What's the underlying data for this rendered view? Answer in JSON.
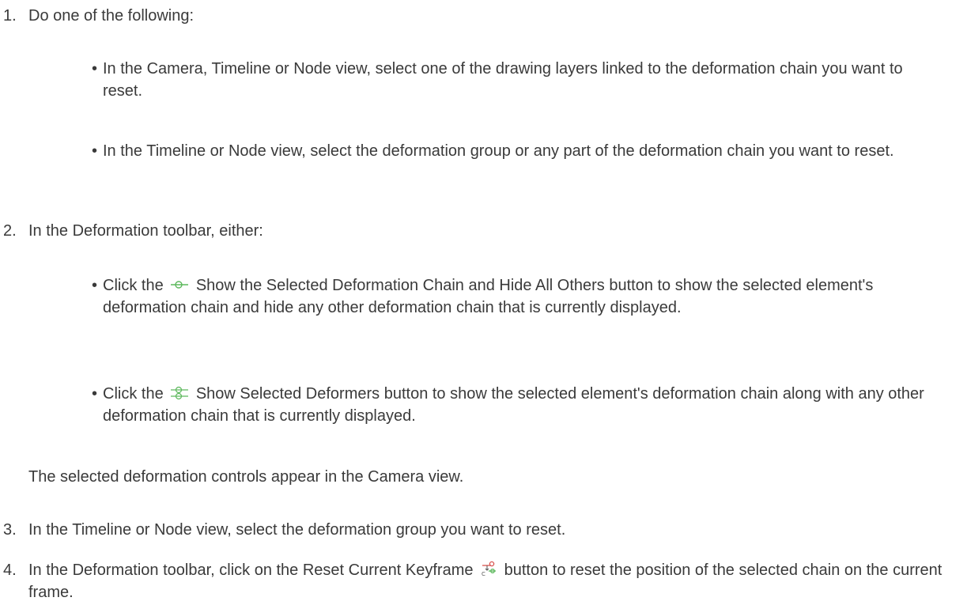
{
  "step1": {
    "num": "1.",
    "text": "Do one of the following:",
    "bullets": [
      "In the Camera, Timeline or Node view, select one of the drawing layers linked to the deformation chain you want to reset.",
      "In the Timeline or Node view, select the deformation group or any part of the deformation chain you want to reset."
    ]
  },
  "step2": {
    "num": "2.",
    "text": "In the Deformation toolbar, either:",
    "bullet1": {
      "before": "Click the",
      "after": "Show the Selected Deformation Chain and Hide All Others button to show the selected element's deformation chain and hide any other deformation chain that is currently displayed."
    },
    "bullet2": {
      "before": "Click the",
      "after": "Show Selected Deformers button to show the selected element's deformation chain along with any other deformation chain that is currently displayed."
    },
    "note": "The selected deformation controls appear in the Camera view."
  },
  "step3": {
    "num": "3.",
    "text": "In the Timeline or Node view, select the deformation group you want to reset."
  },
  "step4": {
    "num": "4.",
    "before": "In the Deformation toolbar, click on the Reset Current Keyframe",
    "after": "button to reset the position of the selected chain on the current frame."
  },
  "icons": {
    "show_chain_hide_others": "deformation-chain-icon",
    "show_selected_deformers": "selected-deformers-icon",
    "reset_current_keyframe": "reset-keyframe-icon"
  },
  "colors": {
    "text": "#3a3a3a",
    "icon_green": "#5cb85c",
    "icon_red": "#d9534f"
  }
}
